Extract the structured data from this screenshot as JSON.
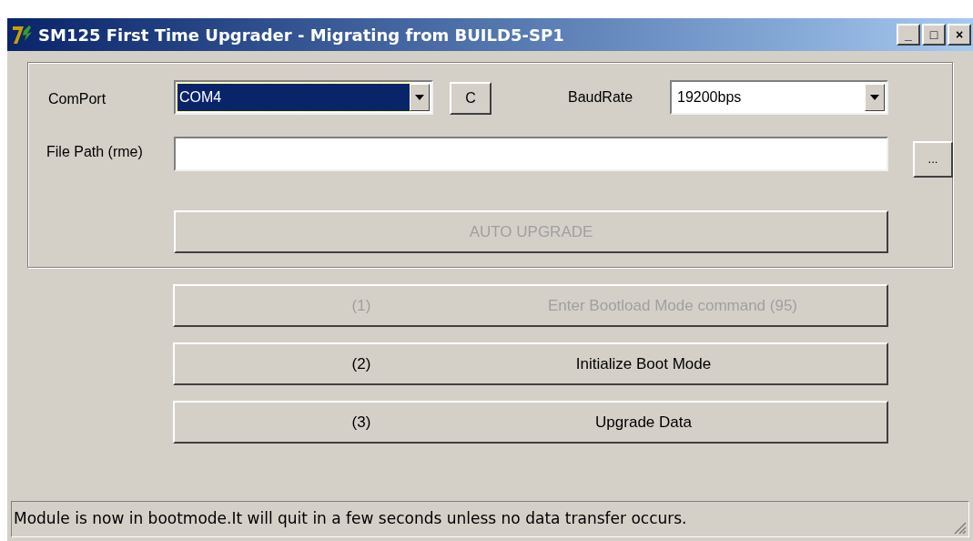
{
  "window": {
    "title": "SM125 First Time Upgrader  - Migrating from BUILD5-SP1",
    "controls": [
      "_",
      "□",
      "×"
    ]
  },
  "comport": {
    "label": "ComPort",
    "value": "COM4",
    "selected": true
  },
  "c_button": {
    "label": "C"
  },
  "baudrate": {
    "label": "BaudRate",
    "value": "19200bps"
  },
  "file_path": {
    "label": "File Path (rme)",
    "browse": "..."
  },
  "auto_upgrade": {
    "label": "AUTO UPGRADE",
    "disabled": true
  },
  "steps": [
    {
      "number": "(1)",
      "label": "Enter Bootload Mode command (95)",
      "disabled": true
    },
    {
      "number": "(2)",
      "label": "Initialize Boot Mode",
      "disabled": false
    },
    {
      "number": "(3)",
      "label": "Upgrade Data",
      "disabled": false
    }
  ],
  "status_bar": {
    "text": "Module is now in bootmode.It will quit in a few seconds unless no data transfer occurs."
  }
}
